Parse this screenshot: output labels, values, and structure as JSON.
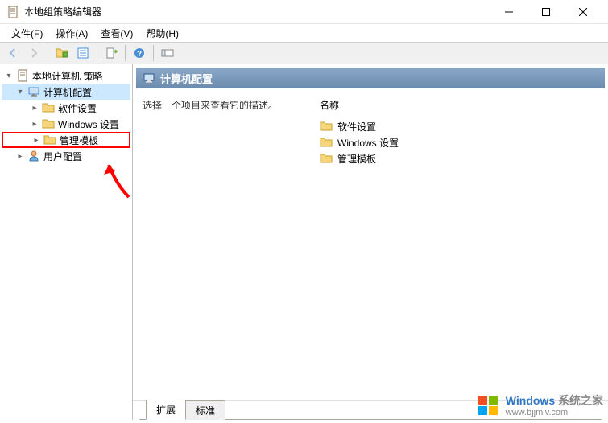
{
  "window": {
    "title": "本地组策略编辑器"
  },
  "menubar": [
    "文件(F)",
    "操作(A)",
    "查看(V)",
    "帮助(H)"
  ],
  "tree": {
    "root": {
      "label": "本地计算机 策略"
    },
    "computer_config": {
      "label": "计算机配置",
      "selected": true
    },
    "software_settings": {
      "label": "软件设置"
    },
    "windows_settings": {
      "label": "Windows 设置"
    },
    "admin_templates": {
      "label": "管理模板",
      "highlighted": true
    },
    "user_config": {
      "label": "用户配置"
    }
  },
  "detail": {
    "header": "计算机配置",
    "description": "选择一个项目来查看它的描述。",
    "column_header": "名称",
    "items": [
      "软件设置",
      "Windows 设置",
      "管理模板"
    ]
  },
  "tabs": {
    "extended": "扩展",
    "standard": "标准",
    "active": "extended"
  },
  "watermark": {
    "brand1": "Windows",
    "brand2": "系统之家",
    "url": "www.bjjmlv.com"
  }
}
